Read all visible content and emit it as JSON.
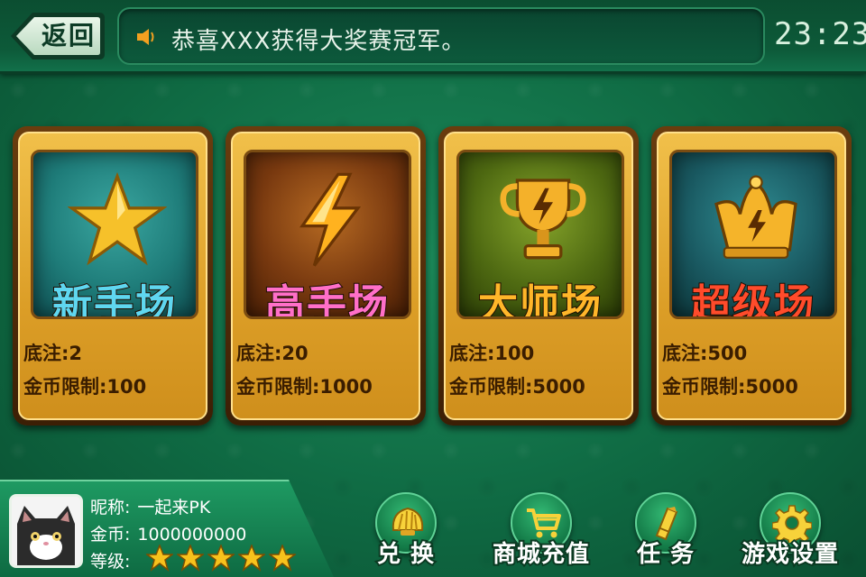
{
  "topbar": {
    "back_label": "返回",
    "notice": "恭喜XXX获得大奖赛冠军。",
    "clock": "23:23"
  },
  "rooms": [
    {
      "name": "新手场",
      "emblem": "star-icon",
      "bet_label": "底注:2",
      "limit_label": "金币限制:100",
      "screen_color": "#1f7d7a",
      "name_color": "#5fd7f0"
    },
    {
      "name": "高手场",
      "emblem": "lightning-icon",
      "bet_label": "底注:20",
      "limit_label": "金币限制:1000",
      "screen_color": "#7a3a10",
      "name_color": "#ff6fc8"
    },
    {
      "name": "大师场",
      "emblem": "trophy-icon",
      "bet_label": "底注:100",
      "limit_label": "金币限制:5000",
      "screen_color": "#4f6a12",
      "name_color": "#ffb629"
    },
    {
      "name": "超级场",
      "emblem": "crown-icon",
      "bet_label": "底注:500",
      "limit_label": "金币限制:5000",
      "screen_color": "#1a5a62",
      "name_color": "#ff4b2b"
    }
  ],
  "player": {
    "nickname_label": "昵称:",
    "nickname": "一起来PK",
    "coins_label": "金币:",
    "coins": "1000000000",
    "level_label": "等级:",
    "level_stars": 5
  },
  "menu": [
    {
      "label": "兑 换",
      "icon": "shell-icon"
    },
    {
      "label": "商城充值",
      "icon": "cart-icon"
    },
    {
      "label": "任 务",
      "icon": "task-icon"
    },
    {
      "label": "游戏设置",
      "icon": "gear-icon"
    }
  ]
}
